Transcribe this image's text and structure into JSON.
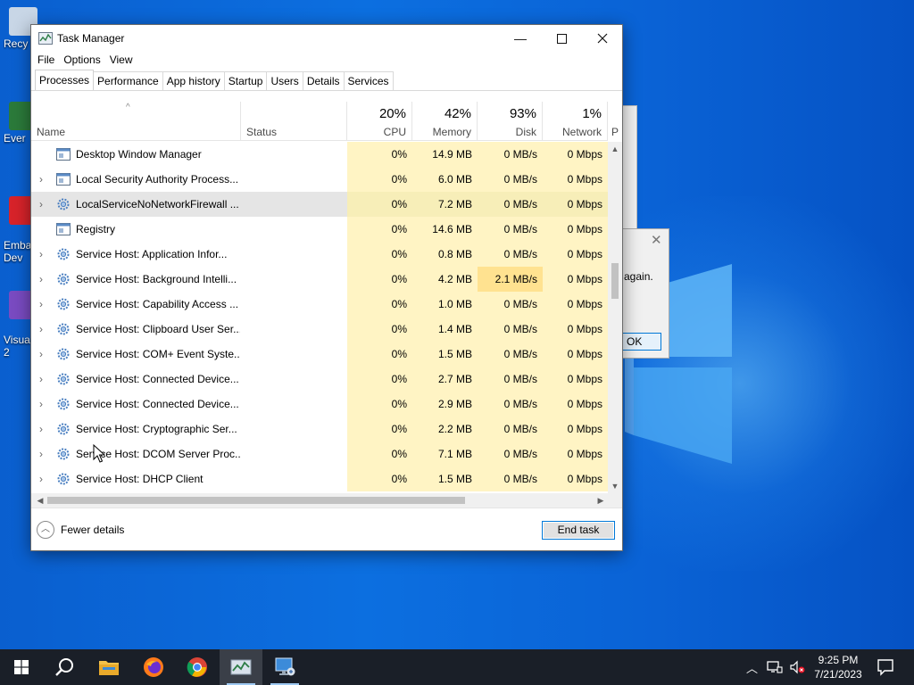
{
  "desktop": {
    "icons": [
      {
        "label": "Recy",
        "color": "#c8d6e6"
      },
      {
        "label": "Ever",
        "color": "#2b7a3a"
      },
      {
        "label": "Emba\nDev",
        "color": "#d8232a"
      },
      {
        "label": "Visua\n2",
        "color": "#7a4bc2"
      }
    ],
    "dialog": {
      "text": "again.",
      "ok_label": "OK"
    }
  },
  "window": {
    "title": "Task Manager",
    "menu": [
      "File",
      "Options",
      "View"
    ],
    "tabs": [
      "Processes",
      "Performance",
      "App history",
      "Startup",
      "Users",
      "Details",
      "Services"
    ],
    "active_tab": "Processes"
  },
  "header": {
    "name_label": "Name",
    "status_label": "Status",
    "cpu": {
      "pct": "20%",
      "label": "CPU"
    },
    "memory": {
      "pct": "42%",
      "label": "Memory"
    },
    "disk": {
      "pct": "93%",
      "label": "Disk"
    },
    "network": {
      "pct": "1%",
      "label": "Network"
    },
    "overflow_label": "P"
  },
  "processes": [
    {
      "name": "Desktop Window Manager",
      "cpu": "0%",
      "memory": "14.9 MB",
      "disk": "0 MB/s",
      "network": "0 Mbps",
      "expand": false,
      "icon": "window"
    },
    {
      "name": "Local Security Authority Process...",
      "cpu": "0%",
      "memory": "6.0 MB",
      "disk": "0 MB/s",
      "network": "0 Mbps",
      "expand": true,
      "icon": "window"
    },
    {
      "name": "LocalServiceNoNetworkFirewall ...",
      "cpu": "0%",
      "memory": "7.2 MB",
      "disk": "0 MB/s",
      "network": "0 Mbps",
      "expand": true,
      "icon": "gear",
      "highlighted": true
    },
    {
      "name": "Registry",
      "cpu": "0%",
      "memory": "14.6 MB",
      "disk": "0 MB/s",
      "network": "0 Mbps",
      "expand": false,
      "icon": "window"
    },
    {
      "name": "Service Host: Application Infor...",
      "cpu": "0%",
      "memory": "0.8 MB",
      "disk": "0 MB/s",
      "network": "0 Mbps",
      "expand": true,
      "icon": "gear"
    },
    {
      "name": "Service Host: Background Intelli...",
      "cpu": "0%",
      "memory": "4.2 MB",
      "disk": "2.1 MB/s",
      "network": "0 Mbps",
      "expand": true,
      "icon": "gear",
      "disk_hot": true
    },
    {
      "name": "Service Host: Capability Access ...",
      "cpu": "0%",
      "memory": "1.0 MB",
      "disk": "0 MB/s",
      "network": "0 Mbps",
      "expand": true,
      "icon": "gear"
    },
    {
      "name": "Service Host: Clipboard User Ser...",
      "cpu": "0%",
      "memory": "1.4 MB",
      "disk": "0 MB/s",
      "network": "0 Mbps",
      "expand": true,
      "icon": "gear"
    },
    {
      "name": "Service Host: COM+ Event Syste...",
      "cpu": "0%",
      "memory": "1.5 MB",
      "disk": "0 MB/s",
      "network": "0 Mbps",
      "expand": true,
      "icon": "gear"
    },
    {
      "name": "Service Host: Connected Device...",
      "cpu": "0%",
      "memory": "2.7 MB",
      "disk": "0 MB/s",
      "network": "0 Mbps",
      "expand": true,
      "icon": "gear"
    },
    {
      "name": "Service Host: Connected Device...",
      "cpu": "0%",
      "memory": "2.9 MB",
      "disk": "0 MB/s",
      "network": "0 Mbps",
      "expand": true,
      "icon": "gear"
    },
    {
      "name": "Service Host: Cryptographic Ser...",
      "cpu": "0%",
      "memory": "2.2 MB",
      "disk": "0 MB/s",
      "network": "0 Mbps",
      "expand": true,
      "icon": "gear"
    },
    {
      "name": "Service Host: DCOM Server Proc...",
      "cpu": "0%",
      "memory": "7.1 MB",
      "disk": "0 MB/s",
      "network": "0 Mbps",
      "expand": true,
      "icon": "gear"
    },
    {
      "name": "Service Host: DHCP Client",
      "cpu": "0%",
      "memory": "1.5 MB",
      "disk": "0 MB/s",
      "network": "0 Mbps",
      "expand": true,
      "icon": "gear"
    }
  ],
  "footer": {
    "fewer_label": "Fewer details",
    "end_task_label": "End task"
  },
  "taskbar": {
    "apps": [
      "windows-start-icon",
      "search-icon",
      "file-explorer-icon",
      "firefox-icon",
      "chrome-icon",
      "task-manager-icon",
      "remote-desktop-icon"
    ],
    "time": "9:25 PM",
    "date": "7/21/2023"
  },
  "colors": {
    "accent": "#0078d7",
    "heat_low": "#fff4c4",
    "heat_mid": "#ffe290",
    "taskbar": "#1a1f28"
  }
}
